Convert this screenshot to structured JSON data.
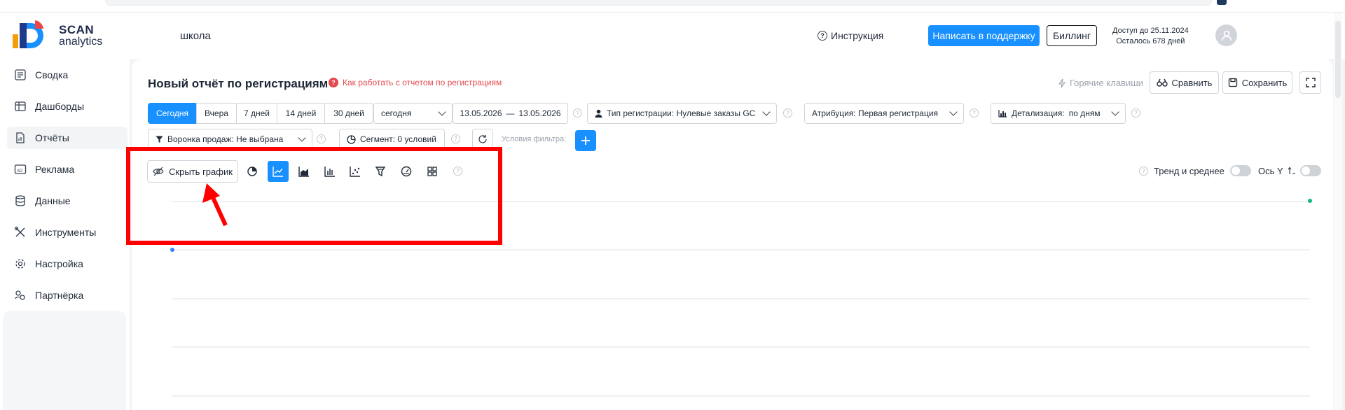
{
  "header": {
    "logo": {
      "line1": "SCAN",
      "line2": "analytics"
    },
    "project_name": "школа",
    "instruction_label": "Инструкция",
    "support_button": "Написать в поддержку",
    "billing_button": "Биллинг",
    "access_line1": "Доступ до 25.11.2024",
    "access_line2": "Осталось 678 дней"
  },
  "sidebar": {
    "items": [
      {
        "label": "Сводка",
        "icon": "summary-icon"
      },
      {
        "label": "Дашборды",
        "icon": "dashboard-icon"
      },
      {
        "label": "Отчёты",
        "icon": "report-icon",
        "active": true
      },
      {
        "label": "Реклама",
        "icon": "ad-icon"
      },
      {
        "label": "Данные",
        "icon": "database-icon"
      },
      {
        "label": "Инструменты",
        "icon": "tools-icon"
      },
      {
        "label": "Настройка",
        "icon": "settings-icon"
      },
      {
        "label": "Партнёрка",
        "icon": "partner-icon"
      }
    ]
  },
  "report": {
    "title": "Новый отчёт по регистрациям",
    "howto_link": "Как работать с отчетом по регистрациям",
    "hotkeys_label": "Горячие клавиши",
    "compare_button": "Сравнить",
    "save_button": "Сохранить"
  },
  "filters": {
    "periods": [
      "Сегодня",
      "Вчера",
      "7 дней",
      "14 дней",
      "30 дней"
    ],
    "active_period": "Сегодня",
    "period_select": "сегодня",
    "date_from": "13.05.2026",
    "date_sep": "—",
    "date_to": "13.05.2026",
    "registration_type": "Тип регистрации: Нулевые заказы GC",
    "attribution": "Атрибуция: Первая регистрация",
    "detail_label": "Детализация:",
    "detail_value": "по дням",
    "funnel": "Воронка продаж: Не выбрана",
    "segment": "Сегмент: 0 условий",
    "filter_placeholder": "Условия фильтра:"
  },
  "chart_toolbar": {
    "hide_chart_button": "Скрыть график",
    "chart_types": [
      "pie-chart-icon",
      "line-chart-icon",
      "area-chart-icon",
      "bar-chart-icon",
      "scatter-chart-icon",
      "funnel-chart-icon",
      "gauge-chart-icon",
      "grid-chart-icon"
    ],
    "active_type": "line-chart-icon",
    "trend_label": "Тренд и среднее",
    "trend_enabled": false,
    "axis_y_label": "Ось Y",
    "axis_y_enabled": false
  },
  "colors": {
    "accent": "#1890ff",
    "annotation_red": "#ff0000",
    "link_red": "#e5484d",
    "series_dot_blue": "#3b82f6",
    "series_dot_green": "#10b981"
  }
}
